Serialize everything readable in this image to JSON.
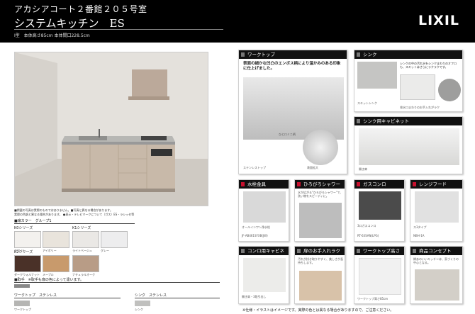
{
  "header": {
    "property": "アカシアコート２番館２０５号室",
    "product": "システムキッチン　ES",
    "spec": "I型　本体高さ85cm 本体間口228.5cm",
    "logo": "LIXIL"
  },
  "left": {
    "notes": [
      "■掲載の写真は実際のものではありません。■写真と異なる場合があります。",
      "実際の色調と異なる場合があります。 ●表示・テレビマークについて（ガス）ES・ラシッセ等"
    ],
    "door_color_label": "■扉カラー　グループ1",
    "series": {
      "a": "K0シリーズ",
      "b": "K1シリーズ",
      "c": "K2シリーズ"
    },
    "swatches": [
      {
        "code": "W1",
        "name": "ホワイト",
        "color": "#f3f1ee"
      },
      {
        "code": "W2",
        "name": "アイボリー",
        "color": "#e9e4dc"
      },
      {
        "code": "W3",
        "name": "ライトベージュ",
        "color": "#eae8e5"
      },
      {
        "code": "W4",
        "name": "グレー",
        "color": "#ededee"
      },
      {
        "code": "W5",
        "name": "ダークウォルナット",
        "color": "#4a3128"
      },
      {
        "code": "W6",
        "name": "メープル",
        "color": "#c89a6c"
      },
      {
        "code": "W7",
        "name": "ナチュラルオーク",
        "color": "#b89c86"
      }
    ],
    "handle_label": "■取手　※取手も扉の色によって違います。",
    "worktop_label": "ワークトップ　ステンレス",
    "sink_label": "シンク　ステンレス",
    "worktop_sub": "ワークトップ",
    "sink_sub": "シンク"
  },
  "panels": {
    "worktop": {
      "title": "ワークトップ",
      "text": "表面の細かな凹凸のエンボス柄により温かみのある印象に仕上げました。",
      "caption1": "ひとロミニ柄",
      "caption2": "表面拡大",
      "caption3": "ステンレストップ"
    },
    "sink": {
      "title": "シンク",
      "text": "シンクの中の汚れ水をシンクまわりのオフロも、スキットはさらにラクラクです。",
      "caption1": "スキットシンク",
      "caption2": "排水口まわりのお手入れがラク"
    },
    "sink_cab": {
      "title": "シンク用キャビネット",
      "caption": "開き扉"
    },
    "faucet": {
      "title": "水栓金具",
      "caption": "オールインワン浄水栓",
      "model": "JF-AB461SYXB(JW)"
    },
    "shower": {
      "title": "ひろびろシャワー",
      "text": "水が広がる\"ひろびろシャワー\"で、洗い物をスピーディに。"
    },
    "stove": {
      "title": "ガスコンロ",
      "caption": "3口ガスコンロ",
      "model": "RT-63SAN(LPG)"
    },
    "hood": {
      "title": "レンジフード",
      "caption": "ス3タイプ",
      "model": "NBH-1A"
    },
    "stove_cab": {
      "title": "コンロ用キャビネット",
      "caption": "開き扉・3段引出し"
    },
    "door_clean": {
      "title": "扉のお手入れラクラク",
      "text": "汚れが拭き取りやすく、美しさが長持ちします。"
    },
    "height": {
      "title": "ワークトップ高さ",
      "caption": "ワークトップ高さ85cm"
    },
    "concept": {
      "title": "商品コンセプト",
      "text": "縁あのいいキッチンは、家づくりの中心となる。"
    }
  },
  "footer": "※仕様・イラストはイメージです。実際の色とは異なる場合がありますので、ご注意ください。"
}
